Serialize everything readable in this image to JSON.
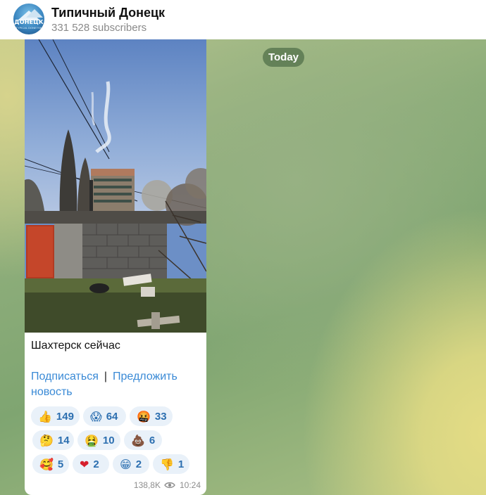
{
  "header": {
    "title": "Типичный Донецк",
    "subscribers": "331 528 subscribers",
    "avatar": {
      "logo_text": "ДОНЕЦК",
      "logo_sub": "TYPICAL DONETSK"
    }
  },
  "date_separator": "Today",
  "message": {
    "caption": "Шахтерск сейчас",
    "link_subscribe": "Подписаться",
    "link_separator": "|",
    "link_suggest": "Предложить новость",
    "reactions": [
      {
        "emoji": "👍",
        "icon": "thumbs-up-icon",
        "count": "149"
      },
      {
        "emoji": "😱",
        "icon": "screaming-face-icon",
        "count": "64"
      },
      {
        "emoji": "🤬",
        "icon": "cursing-face-icon",
        "count": "33"
      },
      {
        "emoji": "🤔",
        "icon": "thinking-face-icon",
        "count": "14"
      },
      {
        "emoji": "🤮",
        "icon": "vomiting-face-icon",
        "count": "10"
      },
      {
        "emoji": "💩",
        "icon": "pile-of-poo-icon",
        "count": "6"
      },
      {
        "emoji": "🥰",
        "icon": "smiling-face-hearts-icon",
        "count": "5"
      },
      {
        "emoji": "❤",
        "icon": "red-heart-icon",
        "count": "2"
      },
      {
        "emoji": "😁",
        "icon": "grinning-face-icon",
        "count": "2"
      },
      {
        "emoji": "👎",
        "icon": "thumbs-down-icon",
        "count": "1"
      }
    ],
    "views": "138,8K",
    "time": "10:24"
  },
  "colors": {
    "link": "#3a8ad6",
    "reaction_bg": "#e9f1f9",
    "reaction_text": "#2c6fb0",
    "meta_text": "#8e8e8e"
  }
}
